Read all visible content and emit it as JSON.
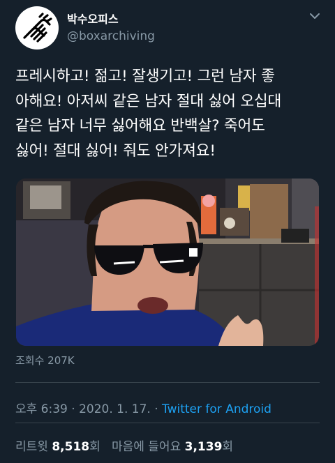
{
  "author": {
    "display_name": "박수오피스",
    "handle": "@boxarchiving",
    "avatar_icon": "clapping-hands-icon"
  },
  "tweet": {
    "text": "프레시하고! 젊고! 잘생기고! 그런 남자 좋\n아해요! 아저씨 같은 남자 절대 싫어 오십대\n같은 남자 너무 싫어해요 반백살? 죽어도\n싫어! 절대 싫어! 줘도 안가져요!",
    "views_label": "조회수 207K"
  },
  "meta": {
    "time": "오후 6:39",
    "separator1": " · ",
    "date": "2020. 1. 17.",
    "separator2": " · ",
    "source": "Twitter for Android"
  },
  "stats": {
    "retweets_label": "리트윗",
    "retweets_count": "8,518",
    "retweets_unit": "회",
    "likes_label": "마음에 들어요",
    "likes_count": "3,139",
    "likes_unit": "회"
  },
  "colors": {
    "background": "#15202b",
    "text": "#ffffff",
    "secondary": "#8899a6",
    "link": "#1da1f2"
  }
}
